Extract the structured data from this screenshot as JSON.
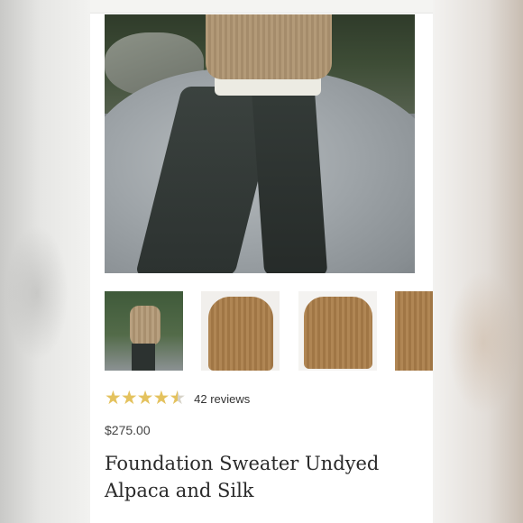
{
  "product": {
    "rating": 4.5,
    "rating_max": 5,
    "reviews_text": "42 reviews",
    "price": "$275.00",
    "title": "Foundation Sweater Undyed Alpaca and Silk"
  },
  "thumbnails": [
    {
      "label": "model-outdoor-view"
    },
    {
      "label": "sweater-side-view"
    },
    {
      "label": "sweater-back-view"
    },
    {
      "label": "sweater-detail-view"
    }
  ],
  "colors": {
    "star": "#e4c25e",
    "text": "#2a2a2a"
  }
}
